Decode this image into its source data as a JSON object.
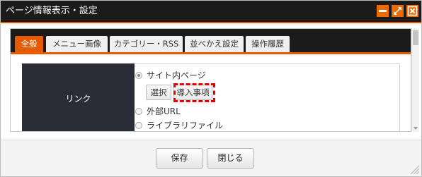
{
  "window": {
    "title": "ページ情報表示・設定",
    "controls": [
      "minimize-icon",
      "maximize-icon",
      "close-icon"
    ],
    "accent_color": "#e85a00",
    "titlebar_color": "#1b1b1b"
  },
  "tabs": [
    {
      "label": "全般",
      "active": true
    },
    {
      "label": "メニュー画像",
      "active": false
    },
    {
      "label": "カテゴリー・RSS",
      "active": false
    },
    {
      "label": "並べかえ設定",
      "active": false
    },
    {
      "label": "操作履歴",
      "active": false
    }
  ],
  "form": {
    "row_label": "リンク",
    "options": [
      {
        "label": "サイト内ページ",
        "checked": true
      },
      {
        "label": "外部URL",
        "checked": false
      },
      {
        "label": "ライブラリファイル",
        "checked": false
      }
    ],
    "select_button": "選択",
    "intro_button": "導入事項",
    "highlight_color": "#e80000"
  },
  "footer": {
    "save_label": "保存",
    "close_label": "閉じる"
  }
}
